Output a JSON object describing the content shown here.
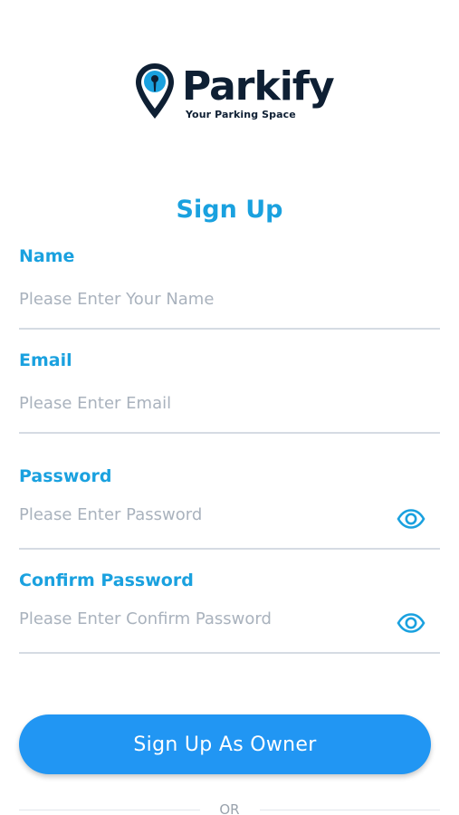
{
  "brand": {
    "name": "Parkify",
    "tagline": "Your Parking Space",
    "logo_icon": "map-pin-icon",
    "pin_color": "#1aa1df",
    "text_color": "#0e1f33"
  },
  "title": "Sign Up",
  "fields": {
    "name": {
      "label": "Name",
      "placeholder": "Please Enter Your Name",
      "value": ""
    },
    "email": {
      "label": "Email",
      "placeholder": "Please Enter Email",
      "value": ""
    },
    "password": {
      "label": "Password",
      "placeholder": "Please Enter Password",
      "value": "",
      "toggle_icon": "eye-icon"
    },
    "confirm_password": {
      "label": "Confirm Password",
      "placeholder": "Please Enter Confirm Password",
      "value": "",
      "toggle_icon": "eye-icon"
    }
  },
  "submit_label": "Sign Up As Owner",
  "divider_text": "OR",
  "colors": {
    "accent": "#1aa1df",
    "button": "#2196f3",
    "placeholder": "#a9b2bd",
    "underline": "#d5dbe3"
  }
}
